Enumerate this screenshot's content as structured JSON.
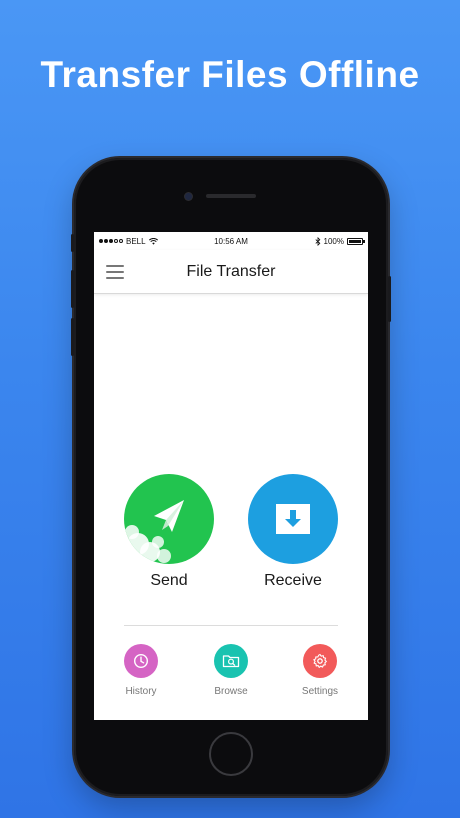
{
  "headline": "Transfer Files Offline",
  "status_bar": {
    "carrier": "BELL",
    "time": "10:56 AM",
    "battery": "100%"
  },
  "app_bar": {
    "title": "File Transfer"
  },
  "actions": {
    "send": {
      "label": "Send",
      "color": "#22c44f",
      "icon": "paper-plane-icon"
    },
    "receive": {
      "label": "Receive",
      "color": "#1d9fe0",
      "icon": "download-box-icon"
    }
  },
  "bottom_nav": [
    {
      "label": "History",
      "color": "#d564c4",
      "icon": "clock-icon"
    },
    {
      "label": "Browse",
      "color": "#19c3b0",
      "icon": "folder-search-icon"
    },
    {
      "label": "Settings",
      "color": "#f25a5a",
      "icon": "gear-icon"
    }
  ],
  "colors": {
    "background_top": "#4a97f5",
    "background_bottom": "#2f74e6"
  }
}
